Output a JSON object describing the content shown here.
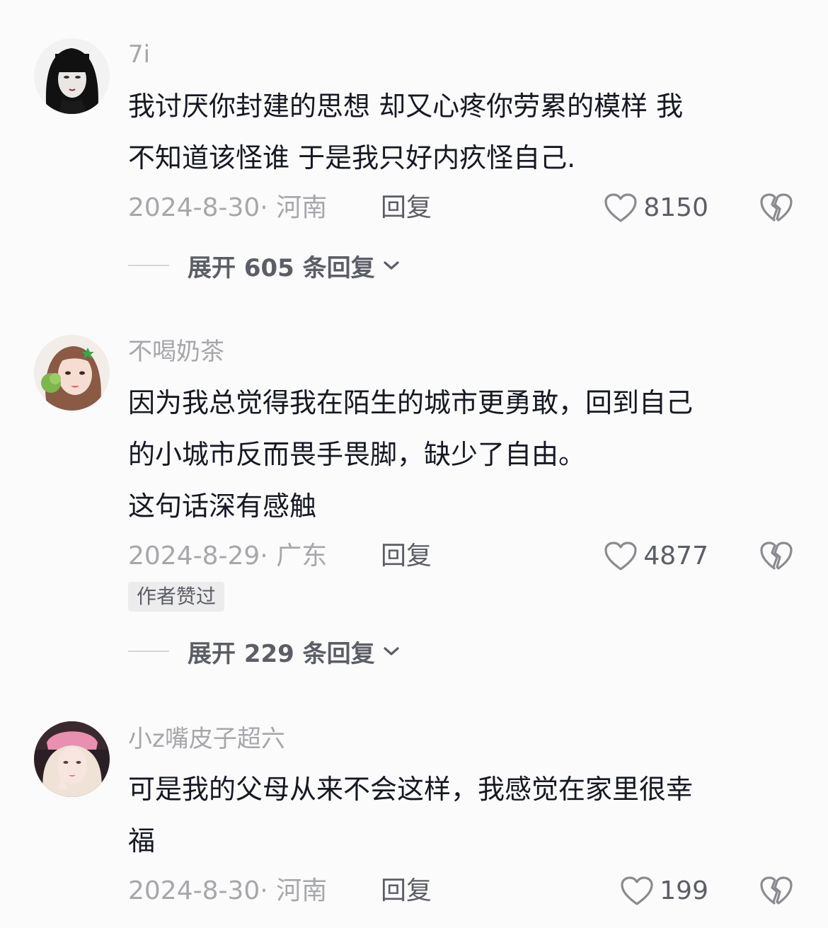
{
  "comments": [
    {
      "username": "7i",
      "lines": [
        "我讨厌你封建的思想 却又心疼你劳累的模样 我",
        "不知道该怪谁 于是我只好内疚怪自己."
      ],
      "date": "2024-8-30· 河南",
      "reply_label": "回复",
      "likes": "8150",
      "expand_label": "展开 605 条回复"
    },
    {
      "username": "不喝奶茶",
      "lines": [
        "因为我总觉得我在陌生的城市更勇敢，回到自己",
        "的小城市反而畏手畏脚，缺少了自由。",
        "这句话深有感触"
      ],
      "date": "2024-8-29· 广东",
      "reply_label": "回复",
      "likes": "4877",
      "badge": "作者赞过",
      "expand_label": "展开 229 条回复"
    },
    {
      "username": "小z嘴皮子超六",
      "lines": [
        "可是我的父母从来不会这样，我感觉在家里很幸",
        "福"
      ],
      "date": "2024-8-30· 河南",
      "reply_label": "回复",
      "likes": "199"
    }
  ],
  "icons": {
    "like": "heart-outline-icon",
    "dislike": "broken-heart-icon",
    "expand": "chevron-down-icon"
  },
  "colors": {
    "text": "#161823",
    "secondary": "#a6a7ab",
    "action": "#5c5e66"
  }
}
